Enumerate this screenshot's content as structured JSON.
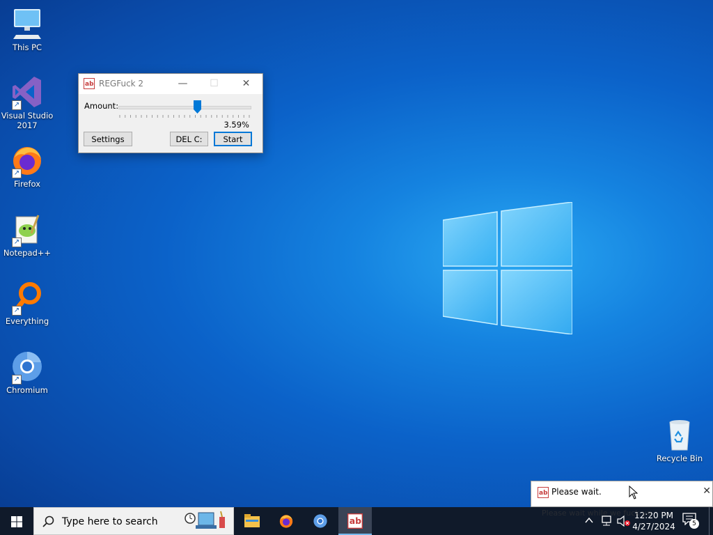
{
  "desktop": {
    "icons": [
      {
        "label": "This PC",
        "icon": "computer-icon"
      },
      {
        "label": "Visual Studio 2017",
        "icon": "visual-studio-icon"
      },
      {
        "label": "Firefox",
        "icon": "firefox-icon"
      },
      {
        "label": "Notepad++",
        "icon": "notepad-plus-plus-icon"
      },
      {
        "label": "Everything",
        "icon": "everything-search-icon"
      },
      {
        "label": "Chromium",
        "icon": "chromium-icon"
      }
    ],
    "recycle_bin": {
      "label": "Recycle Bin",
      "icon": "recycle-bin-icon"
    }
  },
  "app_window": {
    "title": "REGFuck 2",
    "amount_label": "Amount:",
    "slider_fraction": 0.6,
    "percent_text": "3.59%",
    "settings_button": "Settings",
    "del_button": "DEL C:",
    "start_button": "Start",
    "window_controls": {
      "minimize": "—",
      "maximize": "☐",
      "close": "✕"
    }
  },
  "notification": {
    "title": "Please wait.",
    "body": "Please wait while we fuck yo",
    "close": "✕"
  },
  "taskbar": {
    "search_placeholder": "Type here to search",
    "apps": [
      "file-explorer-icon",
      "firefox-icon",
      "chromium-icon",
      "regfuck-icon"
    ],
    "clock_time": "12:20 PM",
    "clock_date": "4/27/2024",
    "notification_count": "5"
  },
  "colors": {
    "accent": "#0078d7",
    "taskbar": "#101a2a",
    "desktop": "#0b62c9"
  }
}
